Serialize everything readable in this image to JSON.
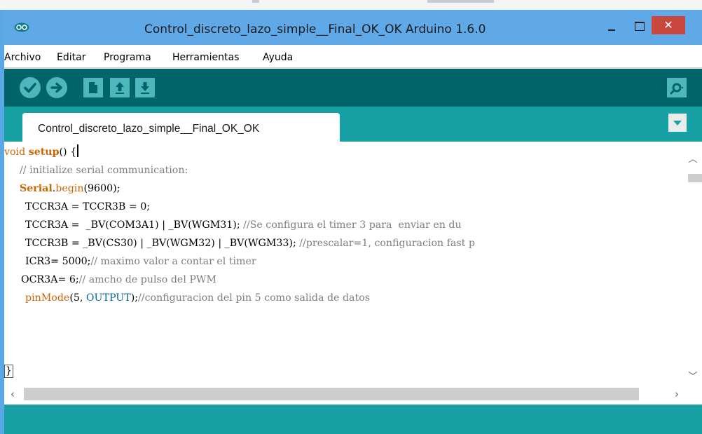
{
  "window": {
    "title": "Control_discreto_lazo_simple__Final_OK_OK Arduino 1.6.0",
    "close_glyph": "✕",
    "colors": {
      "titlebar": "#5fa9e9",
      "toolbar": "#006468",
      "tabbar": "#17a1a5",
      "close": "#c9483d",
      "keyword": "#cc6600",
      "comment": "#7e7e7e",
      "constant": "#006699"
    }
  },
  "menubar": {
    "items": [
      "Archivo",
      "Editar",
      "Programa",
      "Herramientas",
      "Ayuda"
    ]
  },
  "toolbar": {
    "buttons": [
      {
        "name": "verify-button",
        "icon": "checkmark-icon"
      },
      {
        "name": "upload-button",
        "icon": "right-arrow-icon"
      },
      {
        "name": "new-button",
        "icon": "new-document-icon"
      },
      {
        "name": "open-button",
        "icon": "up-arrow-icon"
      },
      {
        "name": "save-button",
        "icon": "down-arrow-icon"
      },
      {
        "name": "serial-monitor-button",
        "icon": "magnifier-icon"
      }
    ]
  },
  "tabs": [
    {
      "label": "Control_discreto_lazo_simple__Final_OK_OK",
      "active": true
    }
  ],
  "editor": {
    "code_lines": [
      "void setup() {",
      "  // initialize serial communication:",
      "  Serial.begin(9600);",
      "   TCCR3A = TCCR3B = 0;",
      "   TCCR3A =  _BV(COM3A1) | _BV(WGM31); //Se configura el timer 3 para  enviar en du",
      "   TCCR3B = _BV(CS30) | _BV(WGM32) | _BV(WGM33); //prescalar=1, configuracion fast p",
      "   ICR3= 5000;// maximo valor a contar el timer",
      "  OCR3A= 6;// amcho de pulso del PWM",
      "   pinMode(5, OUTPUT);//configuracion del pin 5 como salida de datos",
      "",
      "",
      "}"
    ]
  }
}
